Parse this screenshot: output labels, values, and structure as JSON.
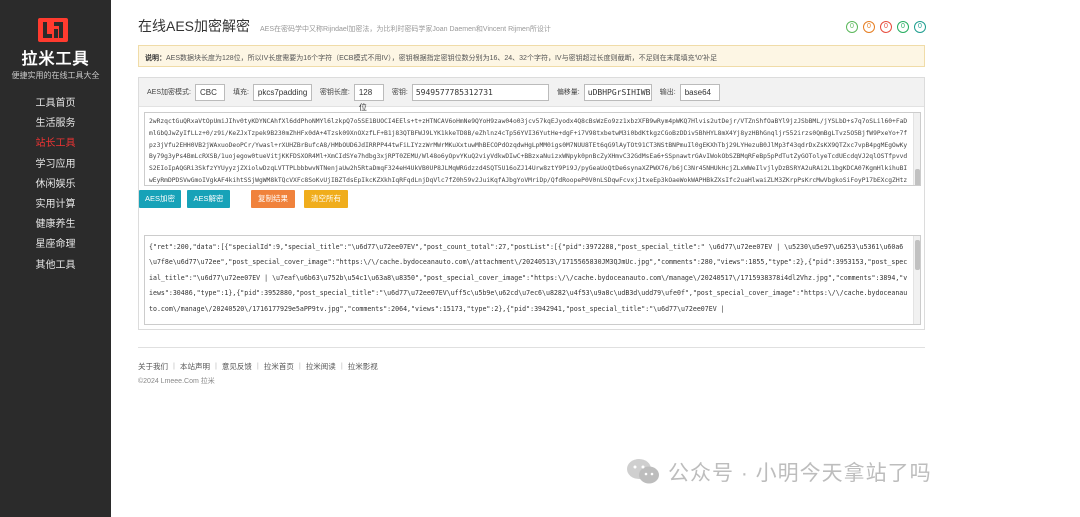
{
  "sidebar": {
    "brand": "拉米工具",
    "tagline": "便捷实用的在线工具大全",
    "items": [
      {
        "label": "工具首页"
      },
      {
        "label": "生活服务"
      },
      {
        "label": "站长工具"
      },
      {
        "label": "学习应用"
      },
      {
        "label": "休闲娱乐"
      },
      {
        "label": "实用计算"
      },
      {
        "label": "健康养生"
      },
      {
        "label": "星座命理"
      },
      {
        "label": "其他工具"
      }
    ],
    "active_index": 2
  },
  "header": {
    "title": "在线AES加密解密",
    "subtitle": "AES在密码学中又称Rijndael加密法，为比利时密码学家Joan Daemen和Vincent Rijmen所设计",
    "circles": [
      {
        "label": "0",
        "color": "#5cb85c"
      },
      {
        "label": "0",
        "color": "#e67e22"
      },
      {
        "label": "0",
        "color": "#e74c3c"
      },
      {
        "label": "0",
        "color": "#27ae60"
      },
      {
        "label": "0",
        "color": "#1e9e8f"
      }
    ]
  },
  "notice": {
    "prefix": "说明：",
    "text": "AES数据块长度为128位，所以IV长度需要为16个字符（ECB模式不用IV），密钥根据指定密钥位数分别为16、24、32个字符，IV与密钥超过长度则截断，不足则在末尾填充'\\0'补足"
  },
  "options": {
    "mode_label": "AES加密模式:",
    "mode_value": "CBC",
    "padding_label": "填充:",
    "padding_value": "pkcs7padding",
    "keylen_label": "密钥长度:",
    "keylen_value": "128位",
    "key_label": "密钥:",
    "key_value": "5949577785312731",
    "iv_label": "偏移量:",
    "iv_value": "uDBHPGrSIHIWB1NT",
    "output_label": "输出:",
    "output_value": "base64"
  },
  "input_text": "2wRzqctGuQRxaVtOpUmiJIhv0tyKDYNCAhfXl6ddPhoNMYl6lzkpQ7o5SE1BUOCI4EEls+t+zHTNCAV6oHmNe9QYoH9zaw04o03jcv57kqEJyodx4Q8cBsWzEo9zz1xbzXFB9wRym4pWKQ7Hlvis2utDejr/VTZnShfOaBYl9jzJSbBML/jYSLbD+s7q7oSLil60+FaDmlGbQJwZyIfLLz+0/z9i/KeZJxTzpek9B230mZhHFx0dA+4Tzsk09XnOXzfLF+B1j83QTBFWJ9LYK1kkeTD8B/eZhlnz4cTp56YVI36YutHe+dgF+i7V98txbetwM3i0bdKtkgzCGoBzDDiv5BhHYL8mX4Yj8yzHBhGnqljr552irzs0QmBgLTvz5O5BjfW9PxeYo+7fpz3jVfu2EHH0VB2jWAxuoDeoPCr/Ywasl+rXUHZBrBufcA8/HMbOUD6JdIRRPP44twFiLIYzzWrMWrMKuXxtuwMhBECOPdOzqdwHgLpMM0igs0M7NUU8TEt6qG9lAyTOt91CT3NStBNPmuIl0gEKXhTbj29LYHezuB0JlMp3f43qdrDxZsKX9QTZxc7vpB4pgMEgOwKyBy79g3yPs4BmLcRXSB/1uojegow0tueVitjKKFDSXOR4Ml+XmCIdSYe7hdbg3xjRPT0ZEMU/Wl48o6yOpvYKuQ2viyVdkwDIwC+BBzxaNuizxWNpyk0pnBcZyXHmvC32GdMsEa6+SSpnawtrGAvIWokObSZBMqRFeBp5pPdTutZyGOTolyeTcdUEcdqVJ2qlOSTfpvvdS2EIoIpAQGRi3SkfzYYUyyzjZXiolwDzqLVTTPLbbbwvNTNenjaUw2h5RtaDmqF324eH4UkVB0UP8JLMqWRGdzzd4SQT5U16oZJ14Urw8ztY9Pi9J/pyGeaUoQtDe6synaXZPWX76/b6jC3Nr45NHUkHcjZLxWWeIlvjlyDzBSRYA2uRAi2L1bgKDCA07KgmHlkihuBIwEyRmDPDSVwGmoIVgkAF4kihtSSjWgWM8kTQcVXFc8SoKvUjIBZTdsEpIkcKZXkhIqRFqdLnjDqVlc7fZ0h59v2JuiKqfAJbgYoVMriDp/QfdRoopeP0V0nLSDqwFcvxjJtxeEp3kOaeWokWAPHBkZXsIfc2uaHlwaiZLM3ZKrpPsKrcMwVbgkoSiFoyP17bEXcgZHtzq/pP3T+rGlBlQeQKLEM5lnWsdos+/fAlzAd+g+ftliiFz7QgvBxZ8Q8YEffYYHL4y8FGwVZqyQl0uBmkywxrahOvQEwQLIw==",
  "buttons": [
    {
      "label": "AES加密",
      "color": "#17a2b8"
    },
    {
      "label": "AES解密",
      "color": "#17a2b8"
    },
    {
      "label": "复制结果",
      "color": "#f0823c"
    },
    {
      "label": "清空所有",
      "color": "#f0ad1c"
    }
  ],
  "output_text": "{\"ret\":200,\"data\":[{\"specialId\":9,\"special_title\":\"\\u6d77\\u72ee07EV\",\"post_count_total\":27,\"postList\":[{\"pid\":3972288,\"post_special_title\":\" \\u6d77\\u72ee07EV | \\u5230\\u5e97\\u6253\\u5361\\u60a6\\u7f8e\\u6d77\\u72ee\",\"post_special_cover_image\":\"https:\\/\\/cache.bydoceanauto.com\\/attachment\\/20240513\\/1715565830JM3QJmUc.jpg\",\"comments\":280,\"views\":1855,\"type\":2},{\"pid\":3953153,\"post_special_title\":\"\\u6d77\\u72ee07EV | \\u7eaf\\u6b63\\u752b\\u54c1\\u63a8\\u8350\",\"post_special_cover_image\":\"https:\\/\\/cache.bydoceanauto.com\\/manage\\/20240517\\/1715938378i4dl2Vhz.jpg\",\"comments\":3894,\"views\":30486,\"type\":1},{\"pid\":3952880,\"post_special_title\":\"\\u6d77\\u72ee07EV\\uff5c\\u5b9e\\u62cd\\u7ec6\\u8282\\u4f53\\u9a8c\\udB3d\\udd79\\ufe0f\",\"post_special_cover_image\":\"https:\\/\\/cache.bydoceanauto.com\\/manage\\/20240520\\/1716177929e5aPP9tv.jpg\",\"comments\":2064,\"views\":15173,\"type\":2},{\"pid\":3942941,\"post_special_title\":\"\\u6d77\\u72ee07EV |",
  "footer": {
    "links": [
      "关于我们",
      "本站声明",
      "意见反馈",
      "拉米首页",
      "拉米阅读",
      "拉米影视"
    ],
    "copyright": "©2024 Lmeee.Com 拉米"
  },
  "watermark": {
    "text": "公众号 · 小明今天拿站了吗"
  }
}
